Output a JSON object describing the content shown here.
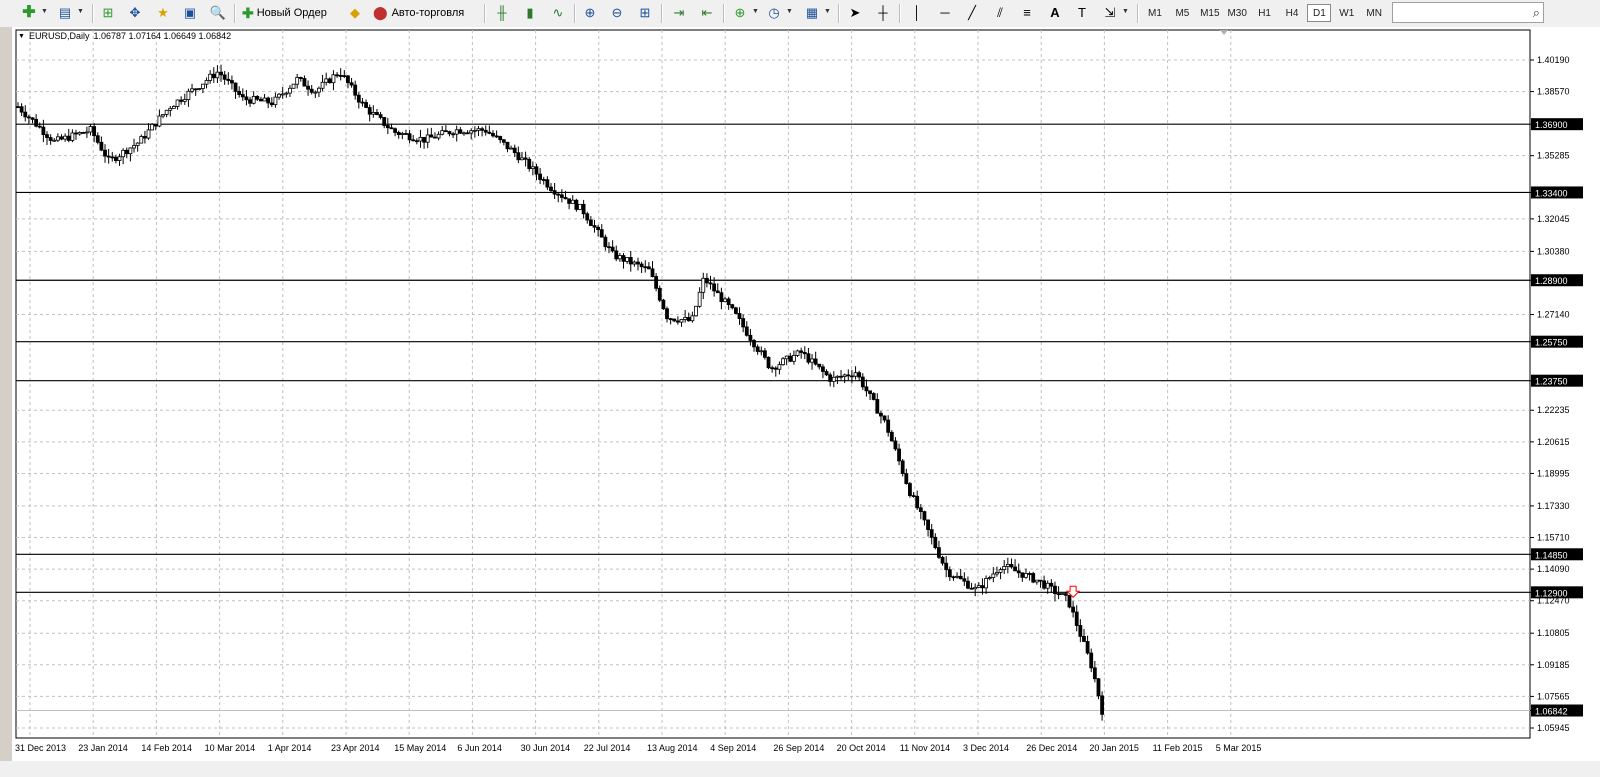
{
  "toolbar": {
    "new_order_label": "Новый Ордер",
    "autotrade_label": "Авто-торговля",
    "timeframes": [
      "M1",
      "M5",
      "M15",
      "M30",
      "H1",
      "H4",
      "D1",
      "W1",
      "MN"
    ],
    "active_timeframe": "D1"
  },
  "chart": {
    "symbol": "EURUSD,Daily",
    "ohlc": "1.06787 1.07164 1.06649 1.06842",
    "colors": {
      "background": "#ffffff",
      "grid": "#c0c0c0",
      "candle": "#000000",
      "axis": "#000000",
      "signal_arrow": "#ff0000"
    },
    "price_axis": {
      "ticks": [
        "1.40190",
        "1.38570",
        "1.36900",
        "1.35285",
        "1.33400",
        "1.32045",
        "1.30380",
        "1.28900",
        "1.27140",
        "1.25750",
        "1.23750",
        "1.22235",
        "1.20615",
        "1.18995",
        "1.17330",
        "1.15710",
        "1.14850",
        "1.14090",
        "1.12900",
        "1.12470",
        "1.10805",
        "1.09185",
        "1.07565",
        "1.06842",
        "1.05945"
      ],
      "min": 1.05945,
      "max": 1.4019
    },
    "horizontal_levels": [
      "1.36900",
      "1.33400",
      "1.28900",
      "1.25750",
      "1.23750",
      "1.14850",
      "1.12900"
    ],
    "current_price": "1.06842",
    "date_axis": [
      "31 Dec 2013",
      "23 Jan 2014",
      "14 Feb 2014",
      "10 Mar 2014",
      "1 Apr 2014",
      "23 Apr 2014",
      "15 May 2014",
      "6 Jun 2014",
      "30 Jun 2014",
      "22 Jul 2014",
      "13 Aug 2014",
      "4 Sep 2014",
      "26 Sep 2014",
      "20 Oct 2014",
      "11 Nov 2014",
      "3 Dec 2014",
      "26 Dec 2014",
      "20 Jan 2015",
      "11 Feb 2015",
      "5 Mar 2015"
    ],
    "price_path": [
      [
        0,
        1.378
      ],
      [
        0.03,
        1.36
      ],
      [
        0.06,
        1.366
      ],
      [
        0.075,
        1.35
      ],
      [
        0.1,
        1.36
      ],
      [
        0.125,
        1.378
      ],
      [
        0.145,
        1.387
      ],
      [
        0.165,
        1.396
      ],
      [
        0.185,
        1.382
      ],
      [
        0.21,
        1.38
      ],
      [
        0.23,
        1.392
      ],
      [
        0.245,
        1.386
      ],
      [
        0.265,
        1.396
      ],
      [
        0.285,
        1.378
      ],
      [
        0.31,
        1.365
      ],
      [
        0.335,
        1.361
      ],
      [
        0.36,
        1.366
      ],
      [
        0.385,
        1.366
      ],
      [
        0.41,
        1.354
      ],
      [
        0.44,
        1.336
      ],
      [
        0.465,
        1.325
      ],
      [
        0.49,
        1.302
      ],
      [
        0.52,
        1.294
      ],
      [
        0.535,
        1.27
      ],
      [
        0.555,
        1.268
      ],
      [
        0.565,
        1.29
      ],
      [
        0.59,
        1.272
      ],
      [
        0.62,
        1.244
      ],
      [
        0.645,
        1.252
      ],
      [
        0.67,
        1.238
      ],
      [
        0.69,
        1.242
      ],
      [
        0.715,
        1.215
      ],
      [
        0.735,
        1.18
      ],
      [
        0.765,
        1.14
      ],
      [
        0.79,
        1.13
      ],
      [
        0.81,
        1.143
      ],
      [
        0.84,
        1.135
      ],
      [
        0.865,
        1.125
      ],
      [
        0.885,
        1.09
      ],
      [
        0.893,
        1.0684
      ]
    ],
    "signal_arrow": {
      "direction": "down",
      "price": 1.127,
      "position": 0.865
    }
  }
}
